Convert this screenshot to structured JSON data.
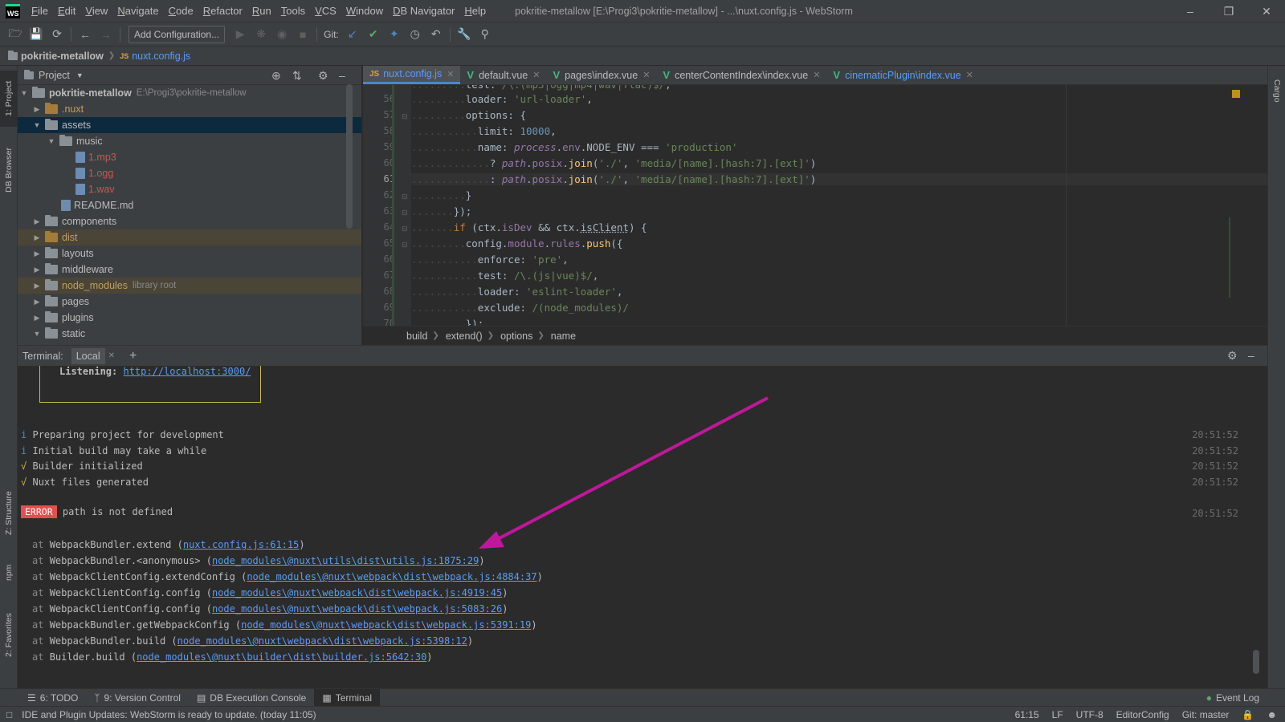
{
  "menubar": {
    "logo_text": "WS",
    "items": [
      "File",
      "Edit",
      "View",
      "Navigate",
      "Code",
      "Refactor",
      "Run",
      "Tools",
      "VCS",
      "Window",
      "DB Navigator",
      "Help"
    ],
    "title": "pokritie-metallow [E:\\Progi3\\pokritie-metallow] - ...\\nuxt.config.js - WebStorm"
  },
  "toolbar": {
    "add_config_label": "Add Configuration...",
    "git_label": "Git:"
  },
  "navbar": {
    "project": "pokritie-metallow",
    "file": "nuxt.config.js"
  },
  "left_strip": {
    "project": "1: Project",
    "db_browser": "DB Browser",
    "structure": "Z: Structure",
    "npm": "npm",
    "favorites": "2: Favorites"
  },
  "right_strip": {
    "cargo": "Cargo"
  },
  "project_panel": {
    "title": "Project",
    "tree": [
      {
        "name": "pokritie-metallow",
        "path": "E:\\Progi3\\pokritie-metallow"
      },
      {
        "name": ".nuxt"
      },
      {
        "name": "assets"
      },
      {
        "name": "music"
      },
      {
        "name": "1.mp3"
      },
      {
        "name": "1.ogg"
      },
      {
        "name": "1.wav"
      },
      {
        "name": "README.md"
      },
      {
        "name": "components"
      },
      {
        "name": "dist"
      },
      {
        "name": "layouts"
      },
      {
        "name": "middleware"
      },
      {
        "name": "node_modules",
        "path": "library root"
      },
      {
        "name": "pages"
      },
      {
        "name": "plugins"
      },
      {
        "name": "static"
      }
    ]
  },
  "editor": {
    "tabs": [
      {
        "label": "nuxt.config.js",
        "active": true
      },
      {
        "label": "default.vue"
      },
      {
        "label": "pages\\index.vue"
      },
      {
        "label": "centerContentIndex\\index.vue"
      },
      {
        "label": "cinematicPlugin\\index.vue"
      }
    ],
    "line_numbers": [
      "56",
      "57",
      "58",
      "59",
      "60",
      "61",
      "62",
      "63",
      "64",
      "65",
      "66",
      "67",
      "68",
      "69",
      "70"
    ],
    "breadcrumbs": [
      "build",
      "extend()",
      "options",
      "name"
    ]
  },
  "terminal": {
    "label": "Terminal:",
    "tab": "Local",
    "listening_label": "Listening:",
    "listening_url": "http://localhost:3000/",
    "info_lines": [
      {
        "prefix": "i",
        "text": "Preparing project for development",
        "time": "20:51:52"
      },
      {
        "prefix": "i",
        "text": "Initial build may take a while",
        "time": "20:51:52"
      },
      {
        "prefix": "√",
        "text": "Builder initialized",
        "time": "20:51:52"
      },
      {
        "prefix": "√",
        "text": "Nuxt files generated",
        "time": "20:51:52"
      }
    ],
    "error_badge": "ERROR",
    "error_text": "path is not defined",
    "error_time": "20:51:52",
    "stack": [
      {
        "fn": "WebpackBundler.extend",
        "loc": "nuxt.config.js:61:15"
      },
      {
        "fn": "WebpackBundler.<anonymous>",
        "loc": "node_modules\\@nuxt\\utils\\dist\\utils.js:1875:29"
      },
      {
        "fn": "WebpackClientConfig.extendConfig",
        "loc": "node_modules\\@nuxt\\webpack\\dist\\webpack.js:4884:37"
      },
      {
        "fn": "WebpackClientConfig.config",
        "loc": "node_modules\\@nuxt\\webpack\\dist\\webpack.js:4919:45"
      },
      {
        "fn": "WebpackClientConfig.config",
        "loc": "node_modules\\@nuxt\\webpack\\dist\\webpack.js:5083:26"
      },
      {
        "fn": "WebpackBundler.getWebpackConfig",
        "loc": "node_modules\\@nuxt\\webpack\\dist\\webpack.js:5391:19"
      },
      {
        "fn": "WebpackBundler.build",
        "loc": "node_modules\\@nuxt\\webpack\\dist\\webpack.js:5398:12"
      },
      {
        "fn": "Builder.build",
        "loc": "node_modules\\@nuxt\\builder\\dist\\builder.js:5642:30"
      }
    ]
  },
  "bottom_tabs": {
    "todo": "6: TODO",
    "vcs": "9: Version Control",
    "db": "DB Execution Console",
    "terminal": "Terminal",
    "event_log": "Event Log"
  },
  "status": {
    "message": "IDE and Plugin Updates: WebStorm is ready to update. (today 11:05)",
    "position": "61:15",
    "line_sep": "LF",
    "encoding": "UTF-8",
    "editorconfig": "EditorConfig",
    "git": "Git: master"
  },
  "colors": {
    "arrow": "#c0179b",
    "accent": "#4a88c7",
    "error": "#e54e4e"
  }
}
